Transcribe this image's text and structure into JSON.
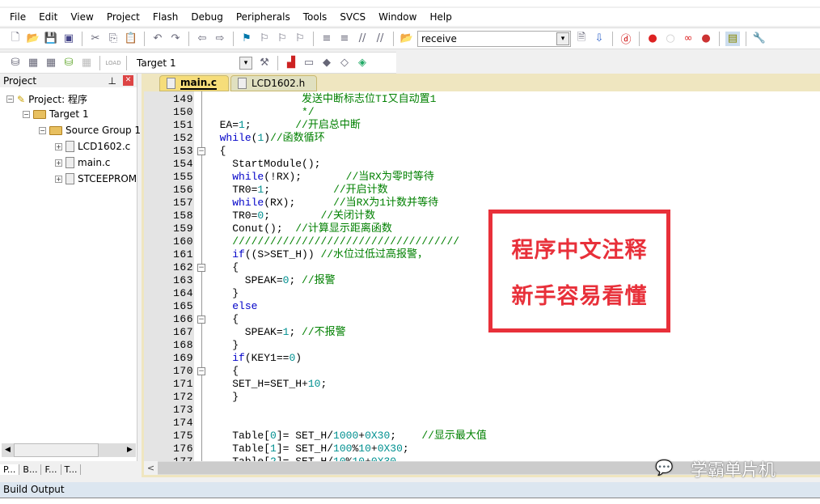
{
  "menu": [
    "File",
    "Edit",
    "View",
    "Project",
    "Flash",
    "Debug",
    "Peripherals",
    "Tools",
    "SVCS",
    "Window",
    "Help"
  ],
  "toolbar1": {
    "find_value": "receive"
  },
  "toolbar2": {
    "target_value": "Target 1",
    "load_label": "LOAD"
  },
  "project_panel": {
    "title": "Project",
    "tree": [
      {
        "label": "Project: 程序",
        "level": 0,
        "icon": "project-icon"
      },
      {
        "label": "Target 1",
        "level": 1,
        "icon": "folder-icon"
      },
      {
        "label": "Source Group 1",
        "level": 2,
        "icon": "folder-icon"
      },
      {
        "label": "LCD1602.c",
        "level": 3,
        "icon": "file-icon"
      },
      {
        "label": "main.c",
        "level": 3,
        "icon": "file-icon"
      },
      {
        "label": "STCEEPROM",
        "level": 3,
        "icon": "file-icon"
      }
    ],
    "tabs": [
      "P...",
      "B...",
      "F...",
      "T..."
    ]
  },
  "editor": {
    "tabs": [
      {
        "label": "main.c",
        "active": true
      },
      {
        "label": "LCD1602.h",
        "active": false
      }
    ],
    "lines": [
      {
        "n": "149",
        "s": [
          [
            "c",
            "               发送中断标志位TI又自动置1"
          ]
        ]
      },
      {
        "n": "150",
        "s": [
          [
            "c",
            "               */"
          ]
        ]
      },
      {
        "n": "151",
        "s": [
          [
            "p",
            "  EA="
          ],
          [
            "n",
            "1"
          ],
          [
            "p",
            ";       "
          ],
          [
            "c",
            "//开启总中断"
          ]
        ]
      },
      {
        "n": "152",
        "s": [
          [
            "p",
            "  "
          ],
          [
            "k",
            "while"
          ],
          [
            "p",
            "("
          ],
          [
            "n",
            "1"
          ],
          [
            "p",
            ")"
          ],
          [
            "c",
            "//函数循环"
          ]
        ]
      },
      {
        "n": "153",
        "fold": true,
        "s": [
          [
            "p",
            "  {"
          ]
        ]
      },
      {
        "n": "154",
        "s": [
          [
            "p",
            "    StartModule();"
          ]
        ]
      },
      {
        "n": "155",
        "s": [
          [
            "p",
            "    "
          ],
          [
            "k",
            "while"
          ],
          [
            "p",
            "(!RX);       "
          ],
          [
            "c",
            "//当RX为零时等待"
          ]
        ]
      },
      {
        "n": "156",
        "s": [
          [
            "p",
            "    TR0="
          ],
          [
            "n",
            "1"
          ],
          [
            "p",
            ";          "
          ],
          [
            "c",
            "//开启计数"
          ]
        ]
      },
      {
        "n": "157",
        "s": [
          [
            "p",
            "    "
          ],
          [
            "k",
            "while"
          ],
          [
            "p",
            "(RX);      "
          ],
          [
            "c",
            "//当RX为1计数并等待"
          ]
        ]
      },
      {
        "n": "158",
        "s": [
          [
            "p",
            "    TR0="
          ],
          [
            "n",
            "0"
          ],
          [
            "p",
            ";        "
          ],
          [
            "c",
            "//关闭计数"
          ]
        ]
      },
      {
        "n": "159",
        "s": [
          [
            "p",
            "    Conut();  "
          ],
          [
            "c",
            "//计算显示距离函数"
          ]
        ]
      },
      {
        "n": "160",
        "s": [
          [
            "c",
            "    ////////////////////////////////////"
          ]
        ]
      },
      {
        "n": "161",
        "s": [
          [
            "p",
            "    "
          ],
          [
            "k",
            "if"
          ],
          [
            "p",
            "((S>SET_H)) "
          ],
          [
            "c",
            "//水位过低过高报警，"
          ]
        ]
      },
      {
        "n": "162",
        "fold": true,
        "s": [
          [
            "p",
            "    {"
          ]
        ]
      },
      {
        "n": "163",
        "s": [
          [
            "p",
            "      SPEAK="
          ],
          [
            "n",
            "0"
          ],
          [
            "p",
            "; "
          ],
          [
            "c",
            "//报警"
          ]
        ]
      },
      {
        "n": "164",
        "s": [
          [
            "p",
            "    }"
          ]
        ]
      },
      {
        "n": "165",
        "s": [
          [
            "p",
            "    "
          ],
          [
            "k",
            "else"
          ]
        ]
      },
      {
        "n": "166",
        "fold": true,
        "s": [
          [
            "p",
            "    {"
          ]
        ]
      },
      {
        "n": "167",
        "s": [
          [
            "p",
            "      SPEAK="
          ],
          [
            "n",
            "1"
          ],
          [
            "p",
            "; "
          ],
          [
            "c",
            "//不报警"
          ]
        ]
      },
      {
        "n": "168",
        "s": [
          [
            "p",
            "    }"
          ]
        ]
      },
      {
        "n": "169",
        "s": [
          [
            "p",
            "    "
          ],
          [
            "k",
            "if"
          ],
          [
            "p",
            "(KEY1=="
          ],
          [
            "n",
            "0"
          ],
          [
            "p",
            ")"
          ]
        ]
      },
      {
        "n": "170",
        "fold": true,
        "s": [
          [
            "p",
            "    {"
          ]
        ]
      },
      {
        "n": "171",
        "s": [
          [
            "p",
            "    SET_H=SET_H+"
          ],
          [
            "n",
            "10"
          ],
          [
            "p",
            ";"
          ]
        ]
      },
      {
        "n": "172",
        "s": [
          [
            "p",
            "    }"
          ]
        ]
      },
      {
        "n": "173",
        "s": []
      },
      {
        "n": "174",
        "s": []
      },
      {
        "n": "175",
        "s": [
          [
            "p",
            "    Table["
          ],
          [
            "n",
            "0"
          ],
          [
            "p",
            "]= SET_H/"
          ],
          [
            "n",
            "1000"
          ],
          [
            "p",
            "+"
          ],
          [
            "n",
            "0X30"
          ],
          [
            "p",
            ";    "
          ],
          [
            "c",
            "//显示最大值"
          ]
        ]
      },
      {
        "n": "176",
        "s": [
          [
            "p",
            "    Table["
          ],
          [
            "n",
            "1"
          ],
          [
            "p",
            "]= SET_H/"
          ],
          [
            "n",
            "100"
          ],
          [
            "p",
            "%"
          ],
          [
            "n",
            "10"
          ],
          [
            "p",
            "+"
          ],
          [
            "n",
            "0X30"
          ],
          [
            "p",
            ";"
          ]
        ]
      },
      {
        "n": "177",
        "s": [
          [
            "p",
            "    Table["
          ],
          [
            "n",
            "2"
          ],
          [
            "p",
            "]= SET_H/"
          ],
          [
            "n",
            "10"
          ],
          [
            "p",
            "%"
          ],
          [
            "n",
            "10"
          ],
          [
            "p",
            "+"
          ],
          [
            "n",
            "0X30"
          ]
        ]
      }
    ]
  },
  "promo": {
    "line1": "程序中文注释",
    "line2": "新手容易看懂",
    "color": "#e8303a"
  },
  "watermark": "学霸单片机",
  "build_output": {
    "title": "Build Output"
  }
}
